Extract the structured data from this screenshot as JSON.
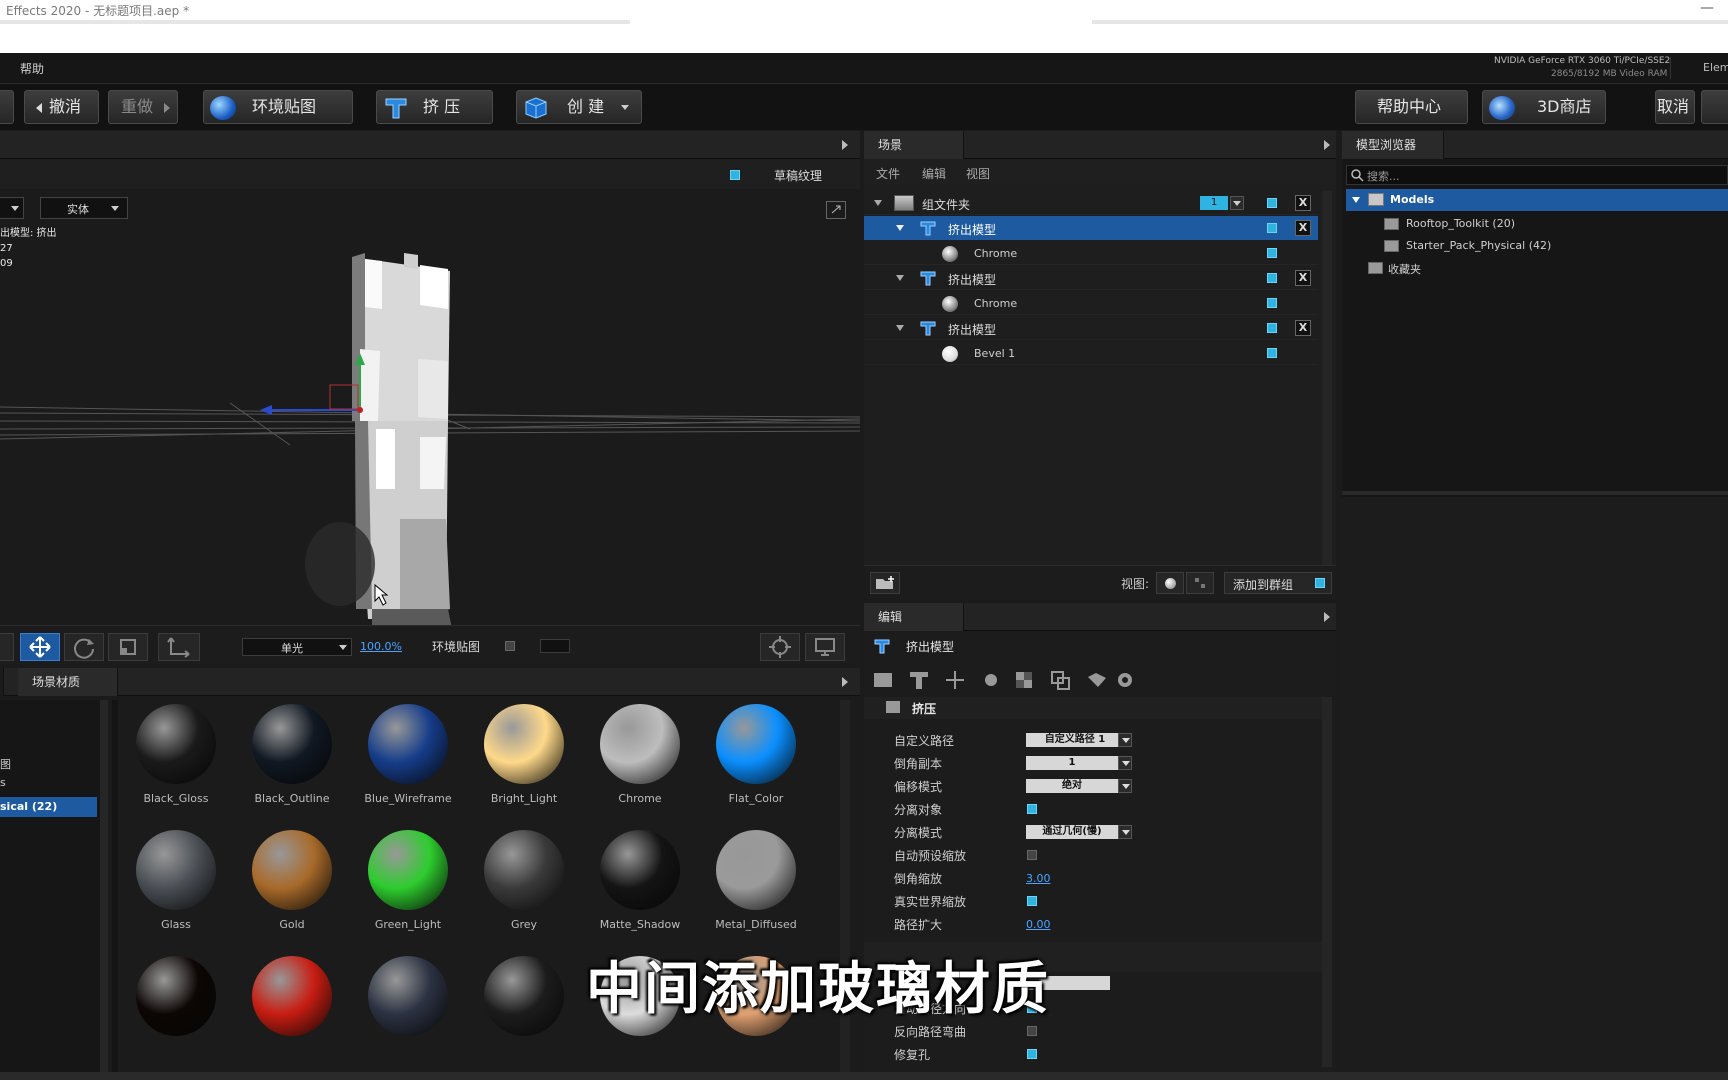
{
  "window": {
    "title": "Effects 2020 - 无标题项目.aep *",
    "minimize": "—"
  },
  "menu": {
    "help": "帮助",
    "gpu_name": "NVIDIA GeForce RTX 3060 Ti/PCIe/SSE2",
    "gpu_mem": "2865/8192 MB Video RAM",
    "elem_label": "Elem"
  },
  "toolbar": {
    "undo": "撤消",
    "redo": "重做",
    "env_map": "环境贴图",
    "extrude": "挤 压",
    "create": "创 建",
    "help_center": "帮助中心",
    "store": "3D商店",
    "cancel": "取消"
  },
  "viewport": {
    "draft_texture": "草稿纹理",
    "render_mode": "实体",
    "info_lines": [
      "出模型: 挤出",
      "27",
      "09"
    ],
    "light_mode": "单光",
    "zoom": "100.0%",
    "env_label": "环境贴图"
  },
  "scene": {
    "tab": "场景",
    "menu": [
      "文件",
      "编辑",
      "视图"
    ],
    "group_name": "组文件夹",
    "group_count": "1",
    "rows": [
      {
        "label": "挤出模型",
        "kind": "model",
        "selected": true
      },
      {
        "label": "Chrome",
        "kind": "material"
      },
      {
        "label": "挤出模型",
        "kind": "model"
      },
      {
        "label": "Chrome",
        "kind": "material"
      },
      {
        "label": "挤出模型",
        "kind": "model"
      },
      {
        "label": "Bevel 1",
        "kind": "material"
      }
    ],
    "view_label": "视图:",
    "add_to_group": "添加到群组"
  },
  "browser": {
    "tab": "模型浏览器",
    "search_placeholder": "搜索...",
    "root": "Models",
    "items": [
      "Rooftop_Toolkit (20)",
      "Starter_Pack_Physical (42)"
    ],
    "favorites": "收藏夹"
  },
  "edit": {
    "tab": "编辑",
    "object_name": "挤出模型",
    "section": "挤压",
    "props": [
      {
        "label": "自定义路径",
        "type": "combo",
        "value": "自定义路径 1"
      },
      {
        "label": "倒角副本",
        "type": "combo",
        "value": "1"
      },
      {
        "label": "偏移模式",
        "type": "combo",
        "value": "绝对"
      },
      {
        "label": "分离对象",
        "type": "check",
        "value": "on"
      },
      {
        "label": "分离模式",
        "type": "combo",
        "value": "通过几何(慢)"
      },
      {
        "label": "自动预设缩放",
        "type": "check",
        "value": "off"
      },
      {
        "label": "倒角缩放",
        "type": "num",
        "value": "3.00"
      },
      {
        "label": "真实世界缩放",
        "type": "check",
        "value": "on"
      },
      {
        "label": "路径扩大",
        "type": "num",
        "value": "0.00"
      }
    ],
    "lower_props": [
      {
        "label": "自动路径方向",
        "type": "check",
        "value": "on"
      },
      {
        "label": "反向路径弯曲",
        "type": "check",
        "value": "off"
      },
      {
        "label": "修复孔",
        "type": "check",
        "value": "on"
      }
    ]
  },
  "materials": {
    "tab": "场景材质",
    "side_items": [
      "图",
      "s",
      "sical (22)"
    ],
    "items": [
      {
        "name": "Black_Gloss",
        "color": "#1a1a1a"
      },
      {
        "name": "Black_Outline",
        "color": "#101822"
      },
      {
        "name": "Blue_Wireframe",
        "color": "#163d8a"
      },
      {
        "name": "Bright_Light",
        "color": "#ffd98a"
      },
      {
        "name": "Chrome",
        "color": "#bdbdbd"
      },
      {
        "name": "Flat_Color",
        "color": "#0a8fff"
      },
      {
        "name": "Glass",
        "color": "#4a4f55"
      },
      {
        "name": "Gold",
        "color": "#a86a2a"
      },
      {
        "name": "Green_Light",
        "color": "#2ecc2e"
      },
      {
        "name": "Grey",
        "color": "#3a3a3a"
      },
      {
        "name": "Matte_Shadow",
        "color": "#141414"
      },
      {
        "name": "Metal_Diffused",
        "color": "#9a9a9a"
      },
      {
        "name": "",
        "color": "#0c0604"
      },
      {
        "name": "",
        "color": "#c81d12"
      },
      {
        "name": "",
        "color": "#2b3242"
      },
      {
        "name": "",
        "color": "#1c1c1c"
      },
      {
        "name": "",
        "color": "#dcdcdc"
      },
      {
        "name": "",
        "color": "#e0a070"
      }
    ]
  },
  "subtitle": "中间添加玻璃材质",
  "colors": {
    "accent": "#2fb3e0",
    "selection": "#1e5aa0",
    "link": "#4aa3ff"
  }
}
